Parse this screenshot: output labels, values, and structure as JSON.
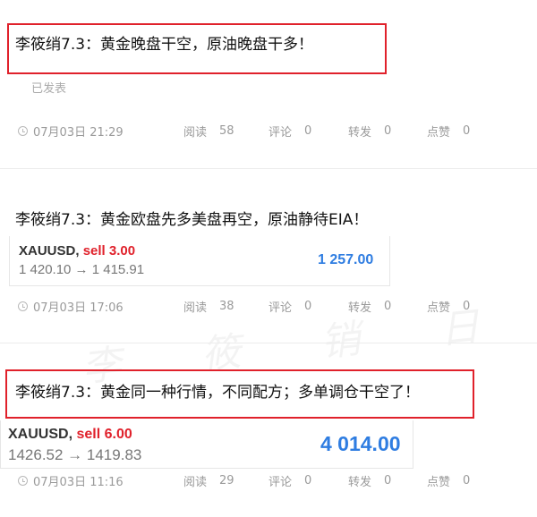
{
  "watermark": "李 筱 销 日",
  "posts": [
    {
      "title": "李筱绡7.3：黄金晚盘干空，原油晚盘干多！",
      "status": "已发表",
      "time": "07月03日 21:29",
      "read_label": "阅读",
      "read_count": "58",
      "comment_label": "评论",
      "comment_count": "0",
      "forward_label": "转发",
      "forward_count": "0",
      "like_label": "点赞",
      "like_count": "0"
    },
    {
      "title": "李筱绡7.3：黄金欧盘先多美盘再空，原油静待EIA！",
      "quote": {
        "symbol": "XAUUSD,",
        "action": "sell 3.00",
        "range": "1 420.10 → 1 415.91",
        "profit": "1 257.00"
      },
      "time": "07月03日 17:06",
      "read_label": "阅读",
      "read_count": "38",
      "comment_label": "评论",
      "comment_count": "0",
      "forward_label": "转发",
      "forward_count": "0",
      "like_label": "点赞",
      "like_count": "0"
    },
    {
      "title": "李筱绡7.3：黄金同一种行情，不同配方；多单调仓干空了！",
      "quote": {
        "symbol": "XAUUSD,",
        "action": "sell 6.00",
        "range": "1426.52 → 1419.83",
        "profit": "4 014.00"
      },
      "time": "07月03日 11:16",
      "read_label": "阅读",
      "read_count": "29",
      "comment_label": "评论",
      "comment_count": "0",
      "forward_label": "转发",
      "forward_count": "0",
      "like_label": "点赞",
      "like_count": "0"
    }
  ],
  "colors": {
    "highlight": "#e0212b",
    "profit": "#2f7de1",
    "sell": "#e0212b"
  }
}
